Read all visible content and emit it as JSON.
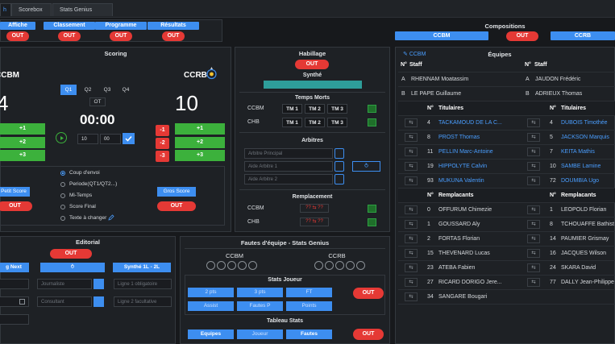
{
  "tabs": [
    {
      "label": "h"
    },
    {
      "label": "Scorebox"
    },
    {
      "label": "Stats Genius  [Never]"
    }
  ],
  "top_buttons": [
    {
      "label": "Affiche",
      "out": "OUT"
    },
    {
      "label": "Classement",
      "out": "OUT"
    },
    {
      "label": "Programme",
      "out": "OUT"
    },
    {
      "label": "Résultats",
      "out": "OUT"
    }
  ],
  "compositions": {
    "title": "Compositions",
    "team1": "CCBM",
    "team2": "CCRB",
    "out": "OUT"
  },
  "scoring": {
    "title": "Scoring",
    "team1": "CCBM",
    "team2": "CCRB",
    "score1": "4",
    "score2": "10",
    "quarters": [
      "Q1",
      "Q2",
      "Q3",
      "Q4"
    ],
    "ot": "OT",
    "clock": "00:00",
    "min": "10",
    "sec": "00",
    "plus": [
      "+1",
      "+2",
      "+3"
    ],
    "minus": [
      "-1",
      "-2",
      "-3"
    ],
    "petit_score": "Petit Score",
    "gros_score": "Gros Score",
    "out": "OUT",
    "radios": [
      "Coup d'envoi",
      "Periode(QT1/QT2...)",
      "Mi-Temps",
      "Score Final",
      "Texte à changer"
    ]
  },
  "habillage": {
    "title": "Habillage",
    "out": "OUT",
    "synthe": "Synthé"
  },
  "temps_morts": {
    "title": "Temps Morts",
    "teams": [
      "CCBM",
      "CHB"
    ],
    "buttons": [
      "TM 1",
      "TM 2",
      "TM 3"
    ]
  },
  "arbitres": {
    "title": "Arbitres",
    "fields": [
      "Arbitre Principal",
      "Aide Arbitre 1",
      "Aide Arbitre 2"
    ]
  },
  "remplacement": {
    "title": "Remplacement",
    "teams": [
      "CCBM",
      "CHB"
    ],
    "marks": "?? ⇆ ??"
  },
  "equipes": {
    "title": "Équipes",
    "team_label": "CCBM",
    "staff": "Staff",
    "num": "N°",
    "titulaires": "Titulaires",
    "remplacants": "Remplacants",
    "left_staff": [
      {
        "r": "A",
        "name": "RHENNAM Moatassim"
      },
      {
        "r": "B",
        "name": "LE PAPE Guillaume"
      }
    ],
    "right_staff": [
      {
        "r": "A",
        "name": "JAUDON Frédéric"
      },
      {
        "r": "B",
        "name": "ADRIEUX Thomas"
      }
    ],
    "left_tit": [
      {
        "n": "4",
        "name": "TACKAMOUD DE LA C..."
      },
      {
        "n": "8",
        "name": "PROST Thomas"
      },
      {
        "n": "11",
        "name": "PELLIN Marc-Antoine"
      },
      {
        "n": "19",
        "name": "HIPPOLYTE Calvin"
      },
      {
        "n": "93",
        "name": "MUKUNA Valentin"
      }
    ],
    "right_tit": [
      {
        "n": "4",
        "name": "DUBOIS Timothée"
      },
      {
        "n": "5",
        "name": "JACKSON Marquis"
      },
      {
        "n": "7",
        "name": "KEITA Mathis"
      },
      {
        "n": "10",
        "name": "SAMBE Lamine"
      },
      {
        "n": "72",
        "name": "DOUMBIA Ugo"
      }
    ],
    "left_rem": [
      {
        "n": "0",
        "name": "OFFURUM Chimezie"
      },
      {
        "n": "1",
        "name": "GOUSSARD Aly"
      },
      {
        "n": "2",
        "name": "FORTAS Florian"
      },
      {
        "n": "15",
        "name": "THEVENARD Lucas"
      },
      {
        "n": "23",
        "name": "ATEBA Fabien"
      },
      {
        "n": "27",
        "name": "RICARD DORIGO Jere..."
      },
      {
        "n": "34",
        "name": "SANGARE Bougari"
      }
    ],
    "right_rem": [
      {
        "n": "1",
        "name": "LEOPOLD Florian"
      },
      {
        "n": "8",
        "name": "TCHOUAFFE Bathist"
      },
      {
        "n": "14",
        "name": "PAUMIER Grismay"
      },
      {
        "n": "16",
        "name": "JACQUES Wilson"
      },
      {
        "n": "24",
        "name": "SKARA David"
      },
      {
        "n": "77",
        "name": "DALLY Jean-Philippe"
      }
    ]
  },
  "editorial": {
    "title": "Editorial",
    "out": "OUT",
    "btn1": "g Next",
    "btn2": "Synthé 1L - 2L",
    "journaliste": "Journaliste",
    "consultant": "Consultant",
    "ligne1": "Ligne 1 obligatoire",
    "ligne2": "Ligne 2 facultative"
  },
  "fautes": {
    "title": "Fautes d'équipe - Stats Genius",
    "team1": "CCBM",
    "team2": "CCRB"
  },
  "stats_joueur": {
    "title": "Stats Joueur",
    "buttons": [
      "2 pts",
      "3 pts",
      "FT",
      "Assist",
      "Fautes P",
      "Points"
    ],
    "out": "OUT"
  },
  "tableau_stats": {
    "title": "Tableau Stats",
    "buttons": [
      "Equipes",
      "Joueur",
      "Fautes"
    ],
    "out": "OUT"
  }
}
